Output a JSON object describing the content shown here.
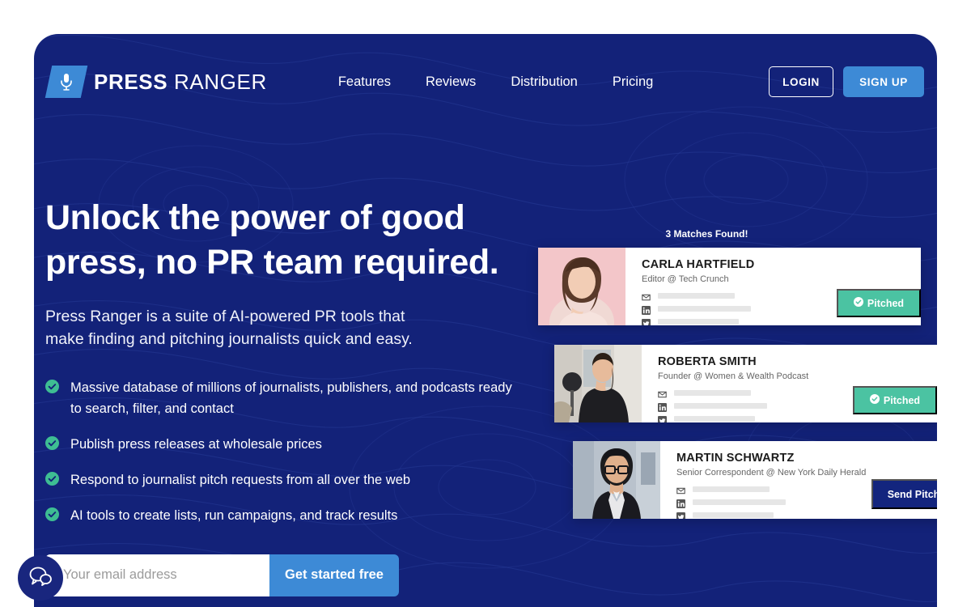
{
  "brand": {
    "name_bold": "PRESS",
    "name_light": "RANGER",
    "logo_icon": "microphone-icon"
  },
  "nav": {
    "links": [
      {
        "label": "Features"
      },
      {
        "label": "Reviews"
      },
      {
        "label": "Distribution"
      },
      {
        "label": "Pricing"
      }
    ],
    "login_label": "LOGIN",
    "signup_label": "SIGN UP"
  },
  "hero": {
    "headline_line1": "Unlock the power of good",
    "headline_line2": "press, no PR team required.",
    "subhead_line1": "Press Ranger is a suite of AI-powered PR tools that",
    "subhead_line2": "make finding and pitching journalists quick and easy.",
    "bullets": [
      {
        "text": "Massive database of millions of journalists, publishers, and podcasts ready to search, filter, and contact"
      },
      {
        "text": "Publish press releases at wholesale prices"
      },
      {
        "text": "Respond to journalist pitch requests from all over the web"
      },
      {
        "text": "AI tools to create lists, run campaigns, and track results"
      }
    ],
    "email_placeholder": "Your email address",
    "email_value": "",
    "cta_label": "Get started free"
  },
  "showcase": {
    "matches_label": "3 Matches Found!",
    "cards": [
      {
        "name": "CARLA HARTFIELD",
        "role": "Editor @ Tech Crunch",
        "cta_label": "Pitched",
        "cta_state": "pitched",
        "contacts": [
          "email-icon",
          "linkedin-icon",
          "twitter-icon"
        ]
      },
      {
        "name": "ROBERTA SMITH",
        "role": "Founder @ Women & Wealth Podcast",
        "cta_label": "Pitched",
        "cta_state": "pitched",
        "contacts": [
          "email-icon",
          "linkedin-icon",
          "twitter-icon"
        ]
      },
      {
        "name": "MARTIN SCHWARTZ",
        "role": "Senior Correspondent @ New York Daily Herald",
        "cta_label": "Send Pitch",
        "cta_state": "send",
        "contacts": [
          "email-icon",
          "linkedin-icon",
          "twitter-icon"
        ]
      }
    ]
  },
  "chat": {
    "icon": "chat-bubbles-icon"
  },
  "colors": {
    "panel_navy": "#132279",
    "accent_blue": "#3d8ad6",
    "success_green": "#4bc3a2",
    "bullet_check": "#3ebd93",
    "deep_navy": "#13257e"
  }
}
